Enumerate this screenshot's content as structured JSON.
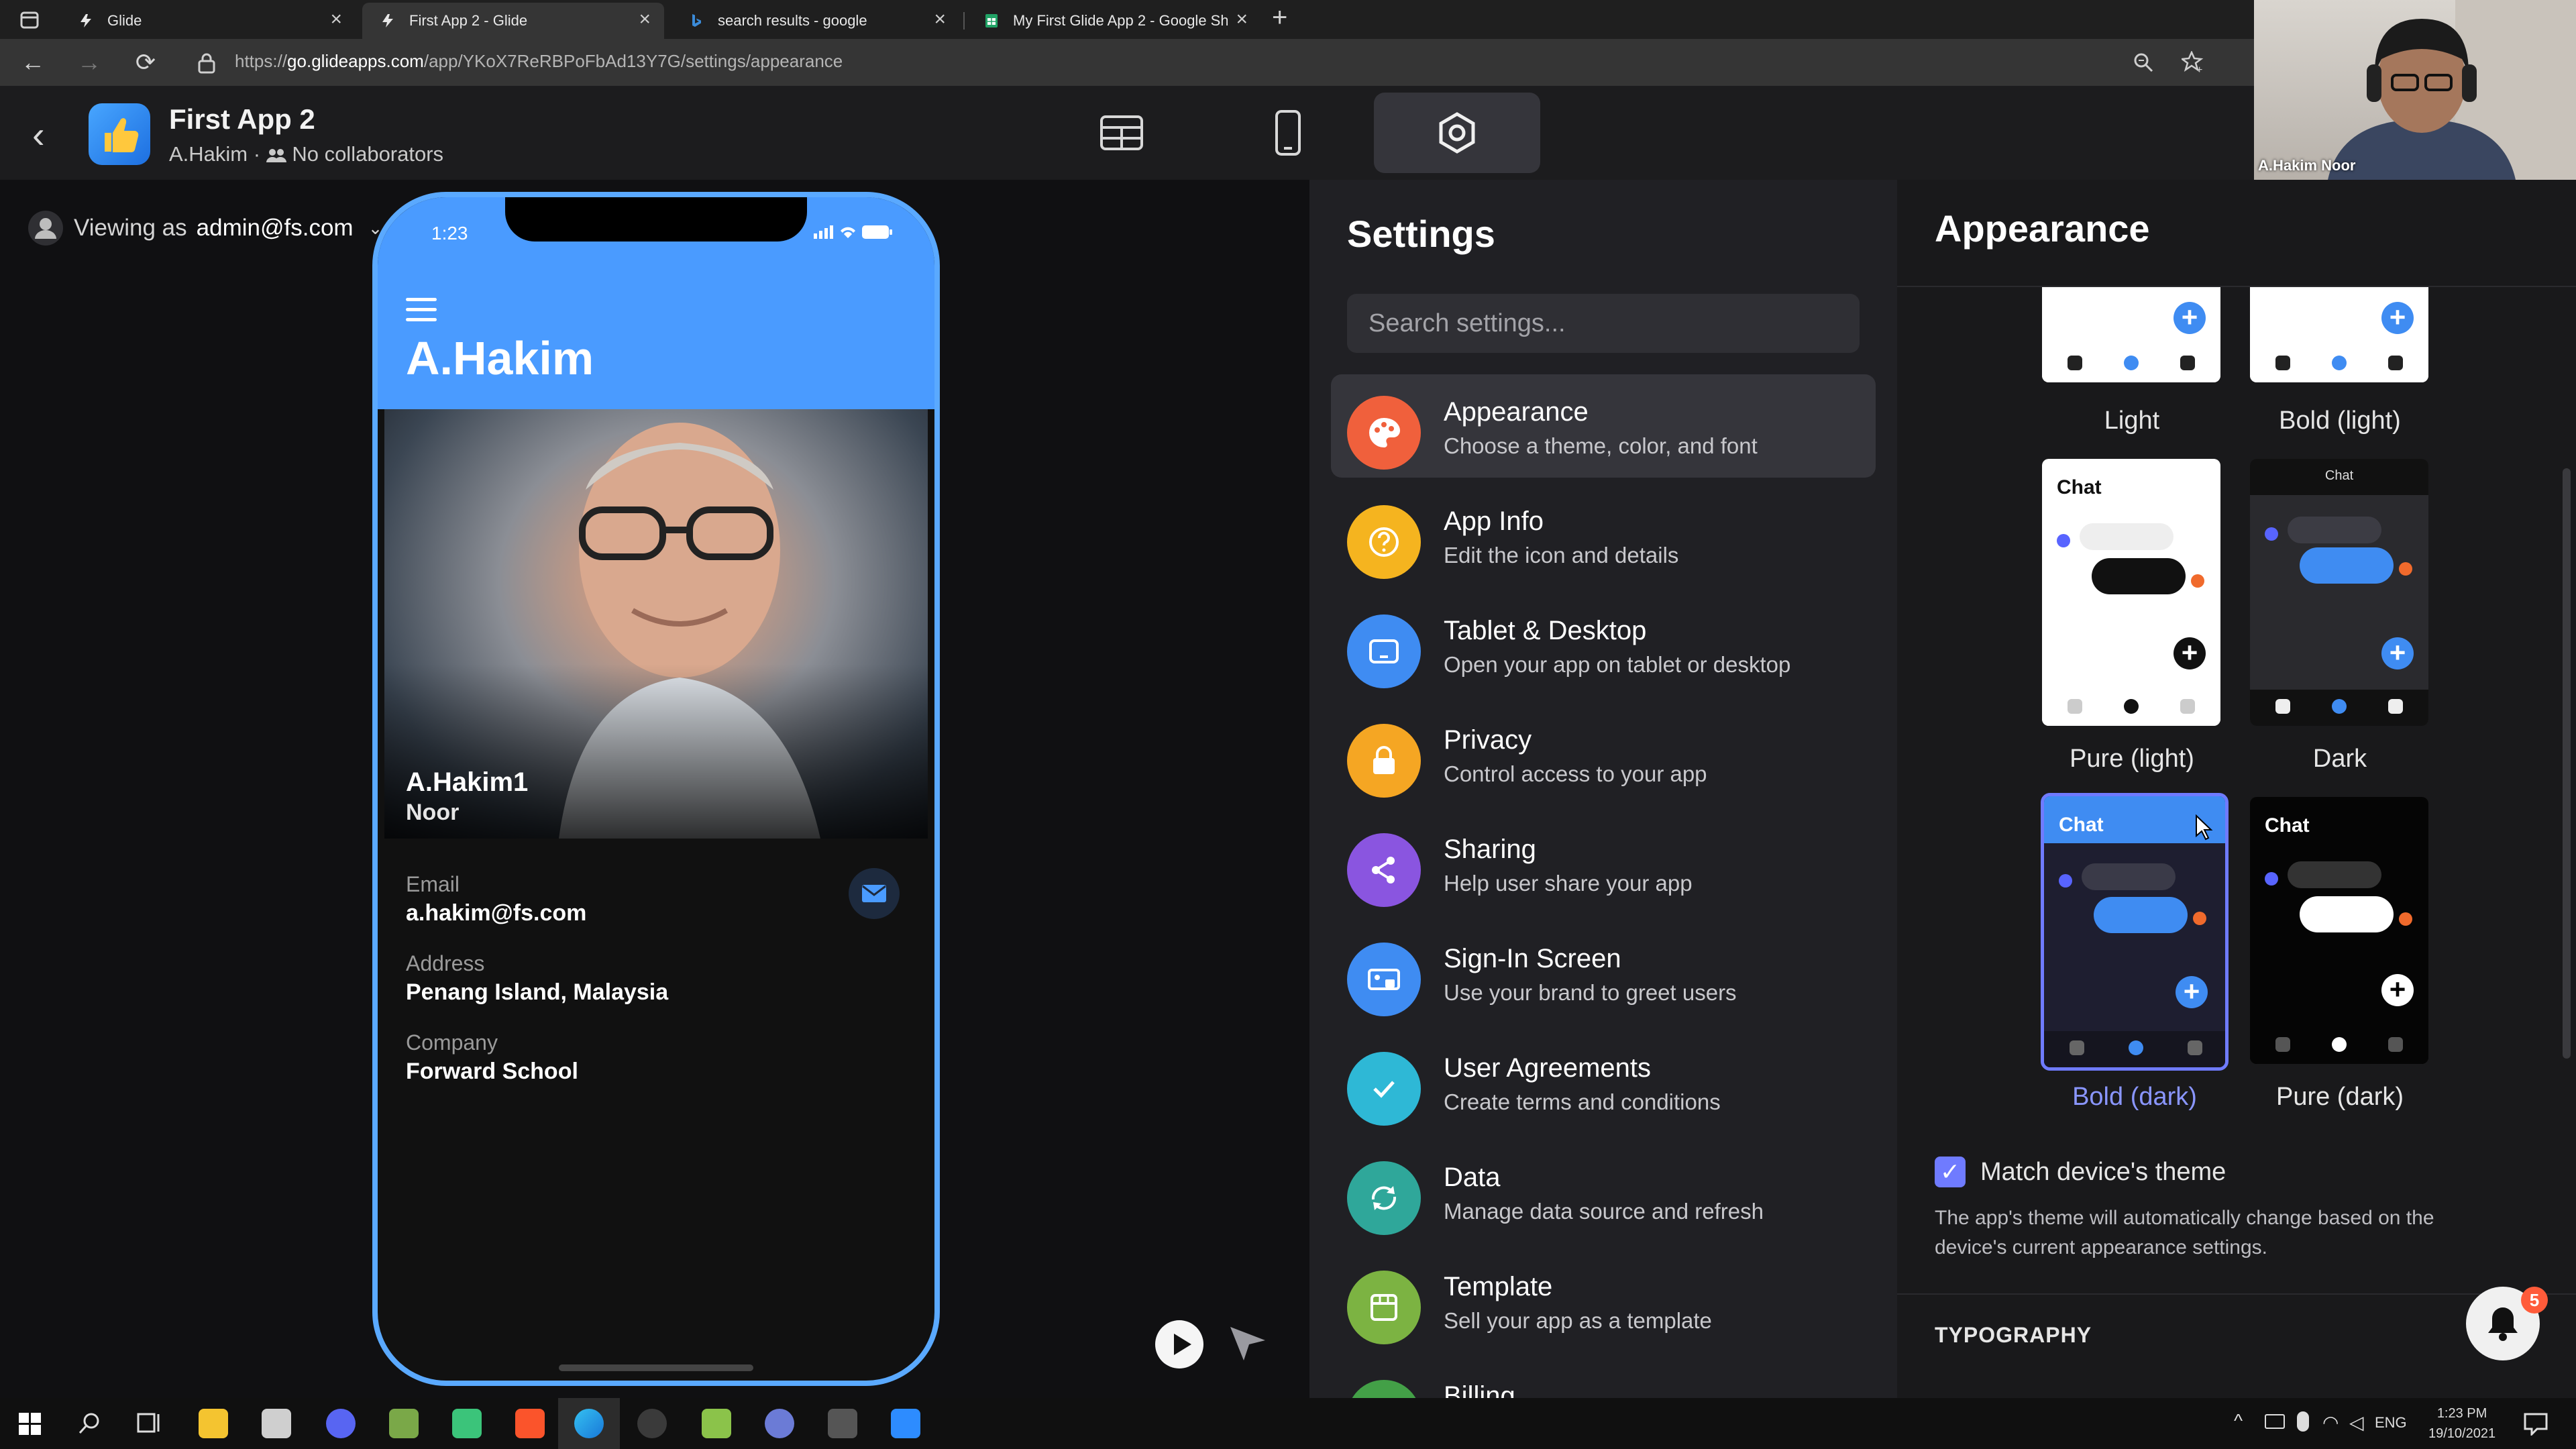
{
  "browser": {
    "tabs": [
      {
        "title": "Glide",
        "active": false
      },
      {
        "title": "First App 2 - Glide",
        "active": true
      },
      {
        "title": "search results - google",
        "active": false
      },
      {
        "title": "My First Glide App 2 - Google Sh",
        "active": false
      }
    ],
    "new_tab": "+",
    "url_prefix": "https://",
    "url_host": "go.glideapps.com",
    "url_path": "/app/YKoX7ReRBPoFbAd13Y7G/settings/appearance"
  },
  "glide_header": {
    "app_name": "First App 2",
    "owner": "A.Hakim",
    "separator": " · ",
    "collaborators": "No collaborators"
  },
  "viewing": {
    "prefix": "Viewing as ",
    "email": "admin@fs.com"
  },
  "phone": {
    "time": "1:23",
    "title": "A.Hakim",
    "caption_title": "A.Hakim1",
    "caption_sub": "Noor",
    "fields": [
      {
        "label": "Email",
        "value": "a.hakim@fs.com"
      },
      {
        "label": "Address",
        "value": "Penang Island, Malaysia"
      },
      {
        "label": "Company",
        "value": "Forward School"
      }
    ]
  },
  "settings": {
    "title": "Settings",
    "search_placeholder": "Search settings...",
    "items": [
      {
        "title": "Appearance",
        "desc": "Choose a theme, color, and font",
        "color": "#f0603c",
        "icon": "palette-icon"
      },
      {
        "title": "App Info",
        "desc": "Edit the icon and details",
        "color": "#f5b41f",
        "icon": "question-icon"
      },
      {
        "title": "Tablet & Desktop",
        "desc": "Open your app on tablet or desktop",
        "color": "#3f8cf2",
        "icon": "tablet-icon"
      },
      {
        "title": "Privacy",
        "desc": "Control access to your app",
        "color": "#f5a623",
        "icon": "lock-icon"
      },
      {
        "title": "Sharing",
        "desc": "Help user share your app",
        "color": "#8a55e0",
        "icon": "share-icon"
      },
      {
        "title": "Sign-In Screen",
        "desc": "Use your brand to greet users",
        "color": "#3f8cf2",
        "icon": "signin-icon"
      },
      {
        "title": "User Agreements",
        "desc": "Create terms and conditions",
        "color": "#2eb8d6",
        "icon": "check-icon"
      },
      {
        "title": "Data",
        "desc": "Manage data source and refresh",
        "color": "#2fa79a",
        "icon": "data-refresh-icon"
      },
      {
        "title": "Template",
        "desc": "Sell your app as a template",
        "color": "#7cb342",
        "icon": "store-icon"
      },
      {
        "title": "Billing",
        "desc": "",
        "color": "#43a047",
        "icon": "dollar-icon"
      }
    ]
  },
  "appearance": {
    "title": "Appearance",
    "theme_chat_label": "Chat",
    "themes": [
      {
        "name": "Light",
        "selected": false
      },
      {
        "name": "Bold (light)",
        "selected": false
      },
      {
        "name": "Pure (light)",
        "selected": false
      },
      {
        "name": "Dark",
        "selected": false
      },
      {
        "name": "Bold (dark)",
        "selected": true
      },
      {
        "name": "Pure (dark)",
        "selected": false
      }
    ],
    "match_theme_label": "Match device's theme",
    "match_theme_checked": true,
    "match_theme_desc": "The app's theme will automatically change based on the device's current appearance settings.",
    "typography_heading": "TYPOGRAPHY",
    "notification_count": "5"
  },
  "webcam": {
    "name": "A.Hakim Noor"
  },
  "taskbar": {
    "lang": "ENG",
    "time": "1:23 PM",
    "date": "19/10/2021"
  },
  "colors": {
    "accent": "#4a9bff",
    "selected_outline": "#6f7bff"
  }
}
